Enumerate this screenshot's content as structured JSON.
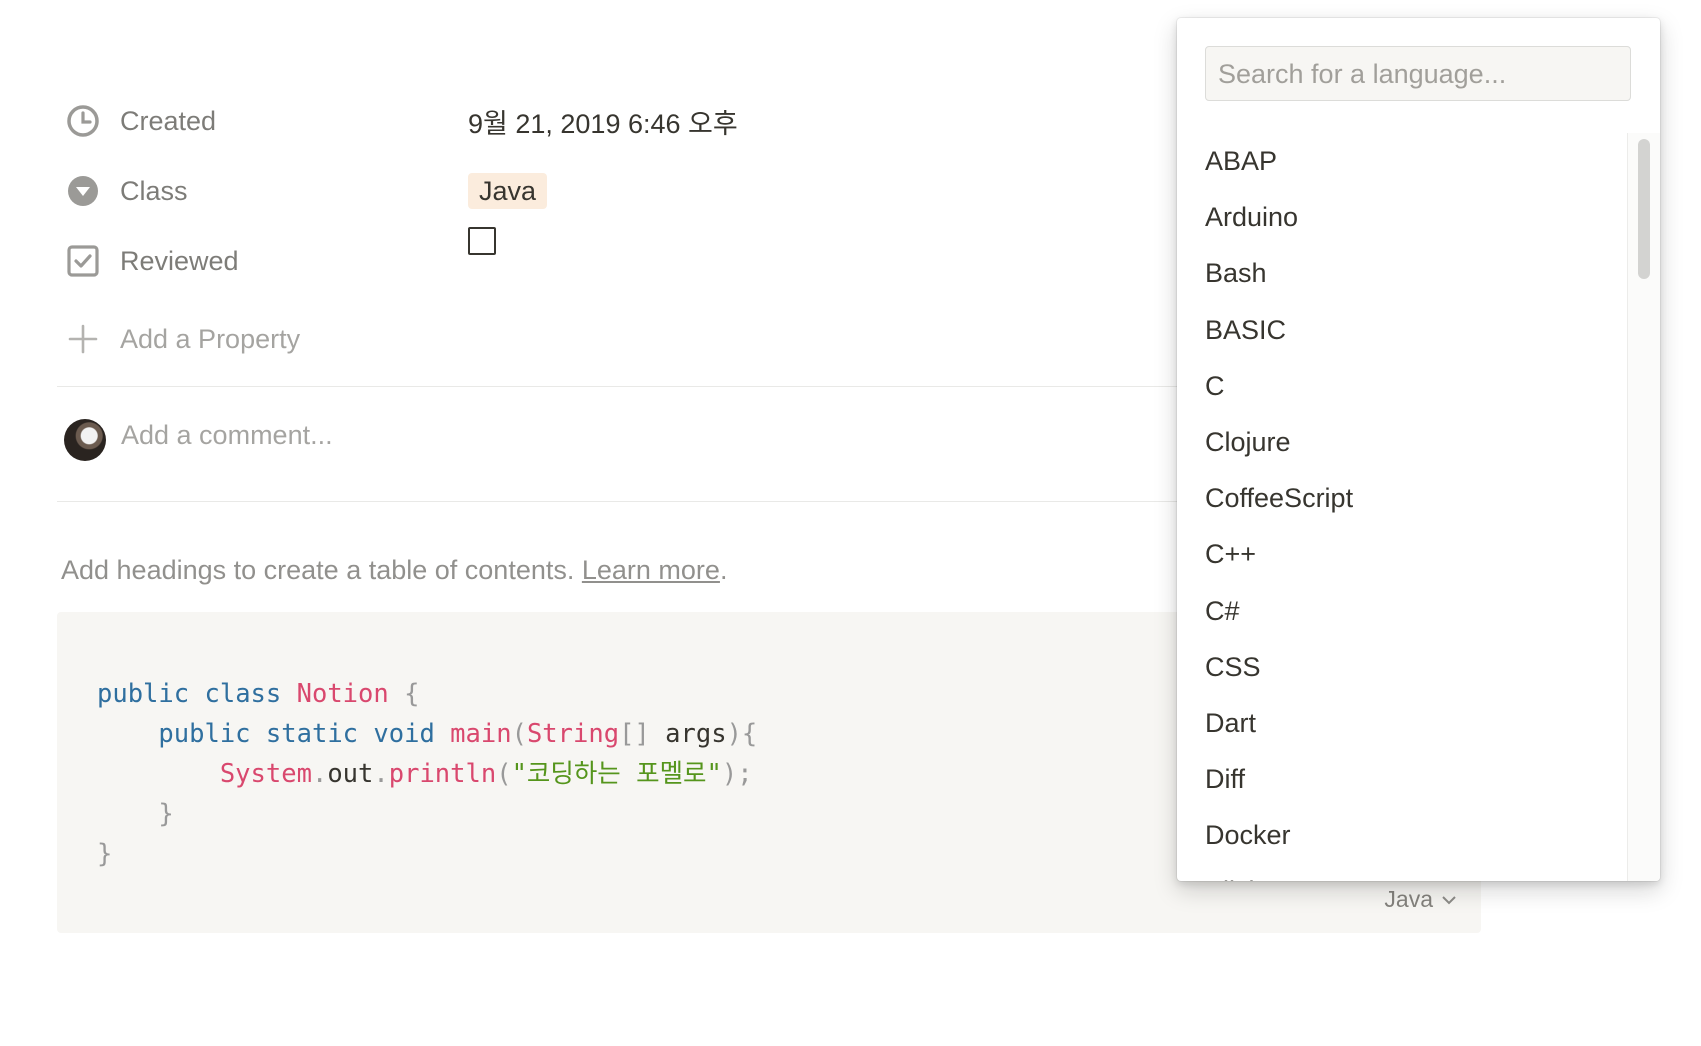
{
  "properties": [
    {
      "label": "Created",
      "value": "9월 21, 2019 6:46 오후",
      "icon": "clock-icon"
    },
    {
      "label": "Class",
      "value": "Java",
      "icon": "select-icon"
    },
    {
      "label": "Reviewed",
      "value": "",
      "icon": "checkbox-icon"
    }
  ],
  "add_property": "Add a Property",
  "comment": {
    "placeholder": "Add a comment..."
  },
  "toc": {
    "text": "Add headings to create a table of contents. ",
    "link": "Learn more",
    "end": "."
  },
  "code_block": {
    "language": "Java",
    "lines": [
      [
        [
          "kw",
          "public"
        ],
        [
          "p",
          " "
        ],
        [
          "kw",
          "class"
        ],
        [
          "p",
          " "
        ],
        [
          "cls",
          "Notion"
        ],
        [
          "p",
          " "
        ],
        [
          "pn",
          "{"
        ]
      ],
      [
        [
          "p",
          "    "
        ],
        [
          "kw",
          "public"
        ],
        [
          "p",
          " "
        ],
        [
          "kw",
          "static"
        ],
        [
          "p",
          " "
        ],
        [
          "kw",
          "void"
        ],
        [
          "p",
          " "
        ],
        [
          "cls",
          "main"
        ],
        [
          "pn",
          "("
        ],
        [
          "cls",
          "String"
        ],
        [
          "pn",
          "[]"
        ],
        [
          "p",
          " args"
        ],
        [
          "pn",
          ")"
        ],
        [
          "pn",
          "{"
        ]
      ],
      [
        [
          "p",
          "        "
        ],
        [
          "cls",
          "System"
        ],
        [
          "pn",
          "."
        ],
        [
          "p",
          "out"
        ],
        [
          "pn",
          "."
        ],
        [
          "cls",
          "println"
        ],
        [
          "pn",
          "("
        ],
        [
          "str",
          "\"코딩하는 포멜로\""
        ],
        [
          "pn",
          ");"
        ]
      ],
      [
        [
          "p",
          "    "
        ],
        [
          "pn",
          "}"
        ]
      ],
      [
        [
          "pn",
          "}"
        ]
      ]
    ]
  },
  "language_menu": {
    "search_placeholder": "Search for a language...",
    "items": [
      "ABAP",
      "Arduino",
      "Bash",
      "BASIC",
      "C",
      "Clojure",
      "CoffeeScript",
      "C++",
      "C#",
      "CSS",
      "Dart",
      "Diff",
      "Docker",
      "Elixir"
    ]
  },
  "colors": {
    "keyword": "#2f6f9f",
    "class": "#d9486e",
    "string": "#55951c",
    "tag_bg": "#fbecdd"
  }
}
